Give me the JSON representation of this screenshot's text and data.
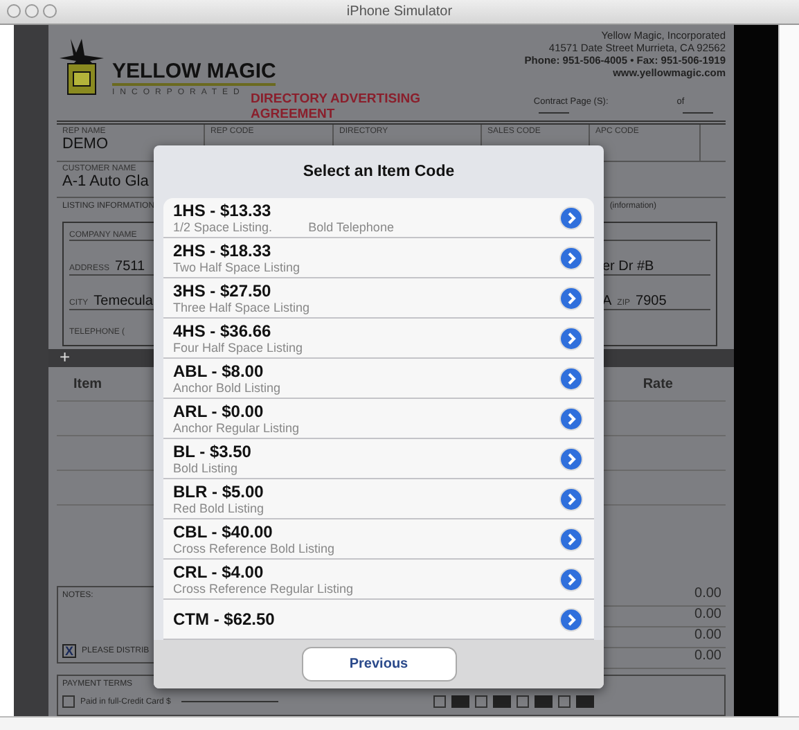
{
  "window": {
    "title": "iPhone Simulator"
  },
  "form": {
    "logo": {
      "name": "YELLOW MAGIC",
      "tagline": "INCORPORATED"
    },
    "company_lines": [
      "Yellow Magic, Incorporated",
      "41571 Date Street Murrieta, CA 92562",
      "Phone: 951-506-4005 • Fax: 951-506-1919",
      "www.yellowmagic.com"
    ],
    "title": "DIRECTORY ADVERTISING AGREEMENT",
    "contract_page": {
      "label": "Contract Page (S):",
      "of": "of"
    },
    "row_1": [
      {
        "label": "REP NAME",
        "value": "DEMO"
      },
      {
        "label": "REP CODE"
      },
      {
        "label": "DIRECTORY"
      },
      {
        "label": "SALES CODE"
      },
      {
        "label": "APC CODE"
      }
    ],
    "customer": {
      "label": "CUSTOMER NAME",
      "value": "A-1 Auto Gla"
    },
    "listing": {
      "label": "LISTING INFORMATION",
      "right_label": "(information)"
    },
    "company_name": {
      "label": "COMPANY NAME"
    },
    "address": {
      "label": "ADDRESS",
      "value": "7511",
      "value_right": "er Dr #B"
    },
    "city": {
      "label": "CITY",
      "value": "Temecula",
      "state": "A",
      "zip_label": "ZIP",
      "zip": "7905"
    },
    "telephone": {
      "label": "TELEPHONE ("
    },
    "add_symbol": "+",
    "table_columns": [
      "Item",
      "Rate"
    ],
    "notes": {
      "label": "NOTES:"
    },
    "distribute": {
      "checked": true,
      "mark": "X",
      "label": "PLEASE DISTRIB"
    },
    "totals": [
      "0.00",
      "0.00",
      "0.00",
      "0.00"
    ],
    "payment": {
      "label": "PAYMENT TERMS",
      "option": "Paid in full-Credit Card $",
      "checked": false,
      "cards": [
        {
          "checked": false
        },
        {
          "checked": false
        },
        {
          "checked": false
        },
        {
          "checked": false
        }
      ]
    }
  },
  "dialog": {
    "title": "Select an Item Code",
    "items": [
      {
        "code": "1HS - $13.33",
        "description": "1/2 Space Listing.",
        "extra": "Bold Telephone"
      },
      {
        "code": "2HS - $18.33",
        "description": "Two Half Space Listing"
      },
      {
        "code": "3HS - $27.50",
        "description": "Three Half Space Listing"
      },
      {
        "code": "4HS - $36.66",
        "description": "Four Half Space Listing"
      },
      {
        "code": "ABL - $8.00",
        "description": "Anchor Bold Listing"
      },
      {
        "code": "ARL - $0.00",
        "description": "Anchor Regular Listing"
      },
      {
        "code": "BL - $3.50",
        "description": "Bold Listing"
      },
      {
        "code": "BLR - $5.00",
        "description": "Red Bold Listing"
      },
      {
        "code": "CBL - $40.00",
        "description": "Cross Reference Bold Listing"
      },
      {
        "code": "CRL - $4.00",
        "description": "Cross Reference Regular Listing"
      },
      {
        "code": "CTM - $62.50"
      }
    ],
    "button": "Previous"
  }
}
